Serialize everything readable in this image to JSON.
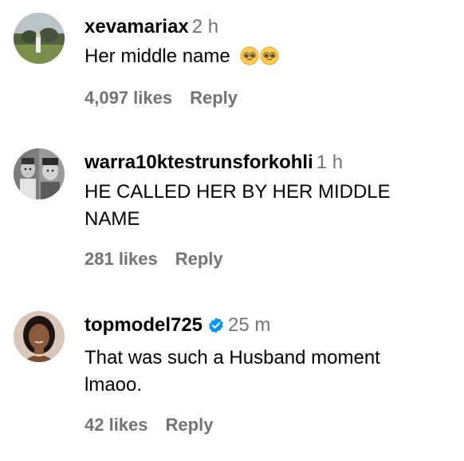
{
  "comments": [
    {
      "username": "xevamariax",
      "time": "2 h",
      "text": "Her middle name",
      "emoji_icons": [
        "pleading-face-emoji",
        "pleading-face-emoji"
      ],
      "likes": "4,097 likes",
      "reply_label": "Reply",
      "verified": false
    },
    {
      "username": "warra10ktestrunsforkohli",
      "time": "1 h",
      "text_lines": [
        "HE CALLED HER BY HER MIDDLE",
        "NAME"
      ],
      "likes": "281 likes",
      "reply_label": "Reply",
      "verified": false
    },
    {
      "username": "topmodel725",
      "time": "25 m",
      "text_lines": [
        "That was such a Husband moment",
        "lmaoo."
      ],
      "likes": "42 likes",
      "reply_label": "Reply",
      "verified": true,
      "verified_icon": "verified-badge-icon"
    }
  ],
  "colors": {
    "username": "#000000",
    "secondary": "#737373",
    "verified_blue": "#0095F6"
  }
}
